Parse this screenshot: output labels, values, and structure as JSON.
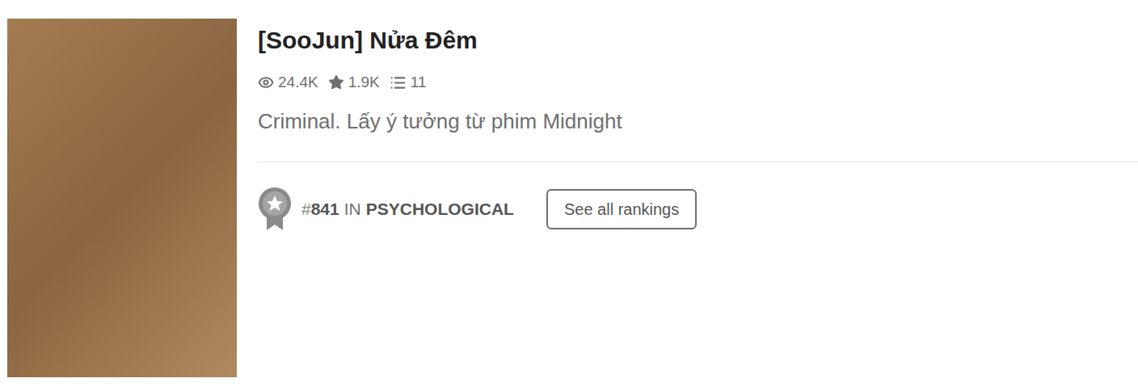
{
  "story": {
    "title": "[SooJun] Nửa Đêm",
    "stats": [
      {
        "kind": "reads",
        "value": "24.4K"
      },
      {
        "kind": "votes",
        "value": "1.9K"
      },
      {
        "kind": "parts",
        "value": "11"
      }
    ],
    "description": "Criminal. Lấy ý tưởng từ phim Midnight"
  },
  "ranking": {
    "prefix": "#",
    "rank": "841",
    "separator": "IN",
    "category": "PSYCHOLOGICAL",
    "button": "See all rankings"
  }
}
